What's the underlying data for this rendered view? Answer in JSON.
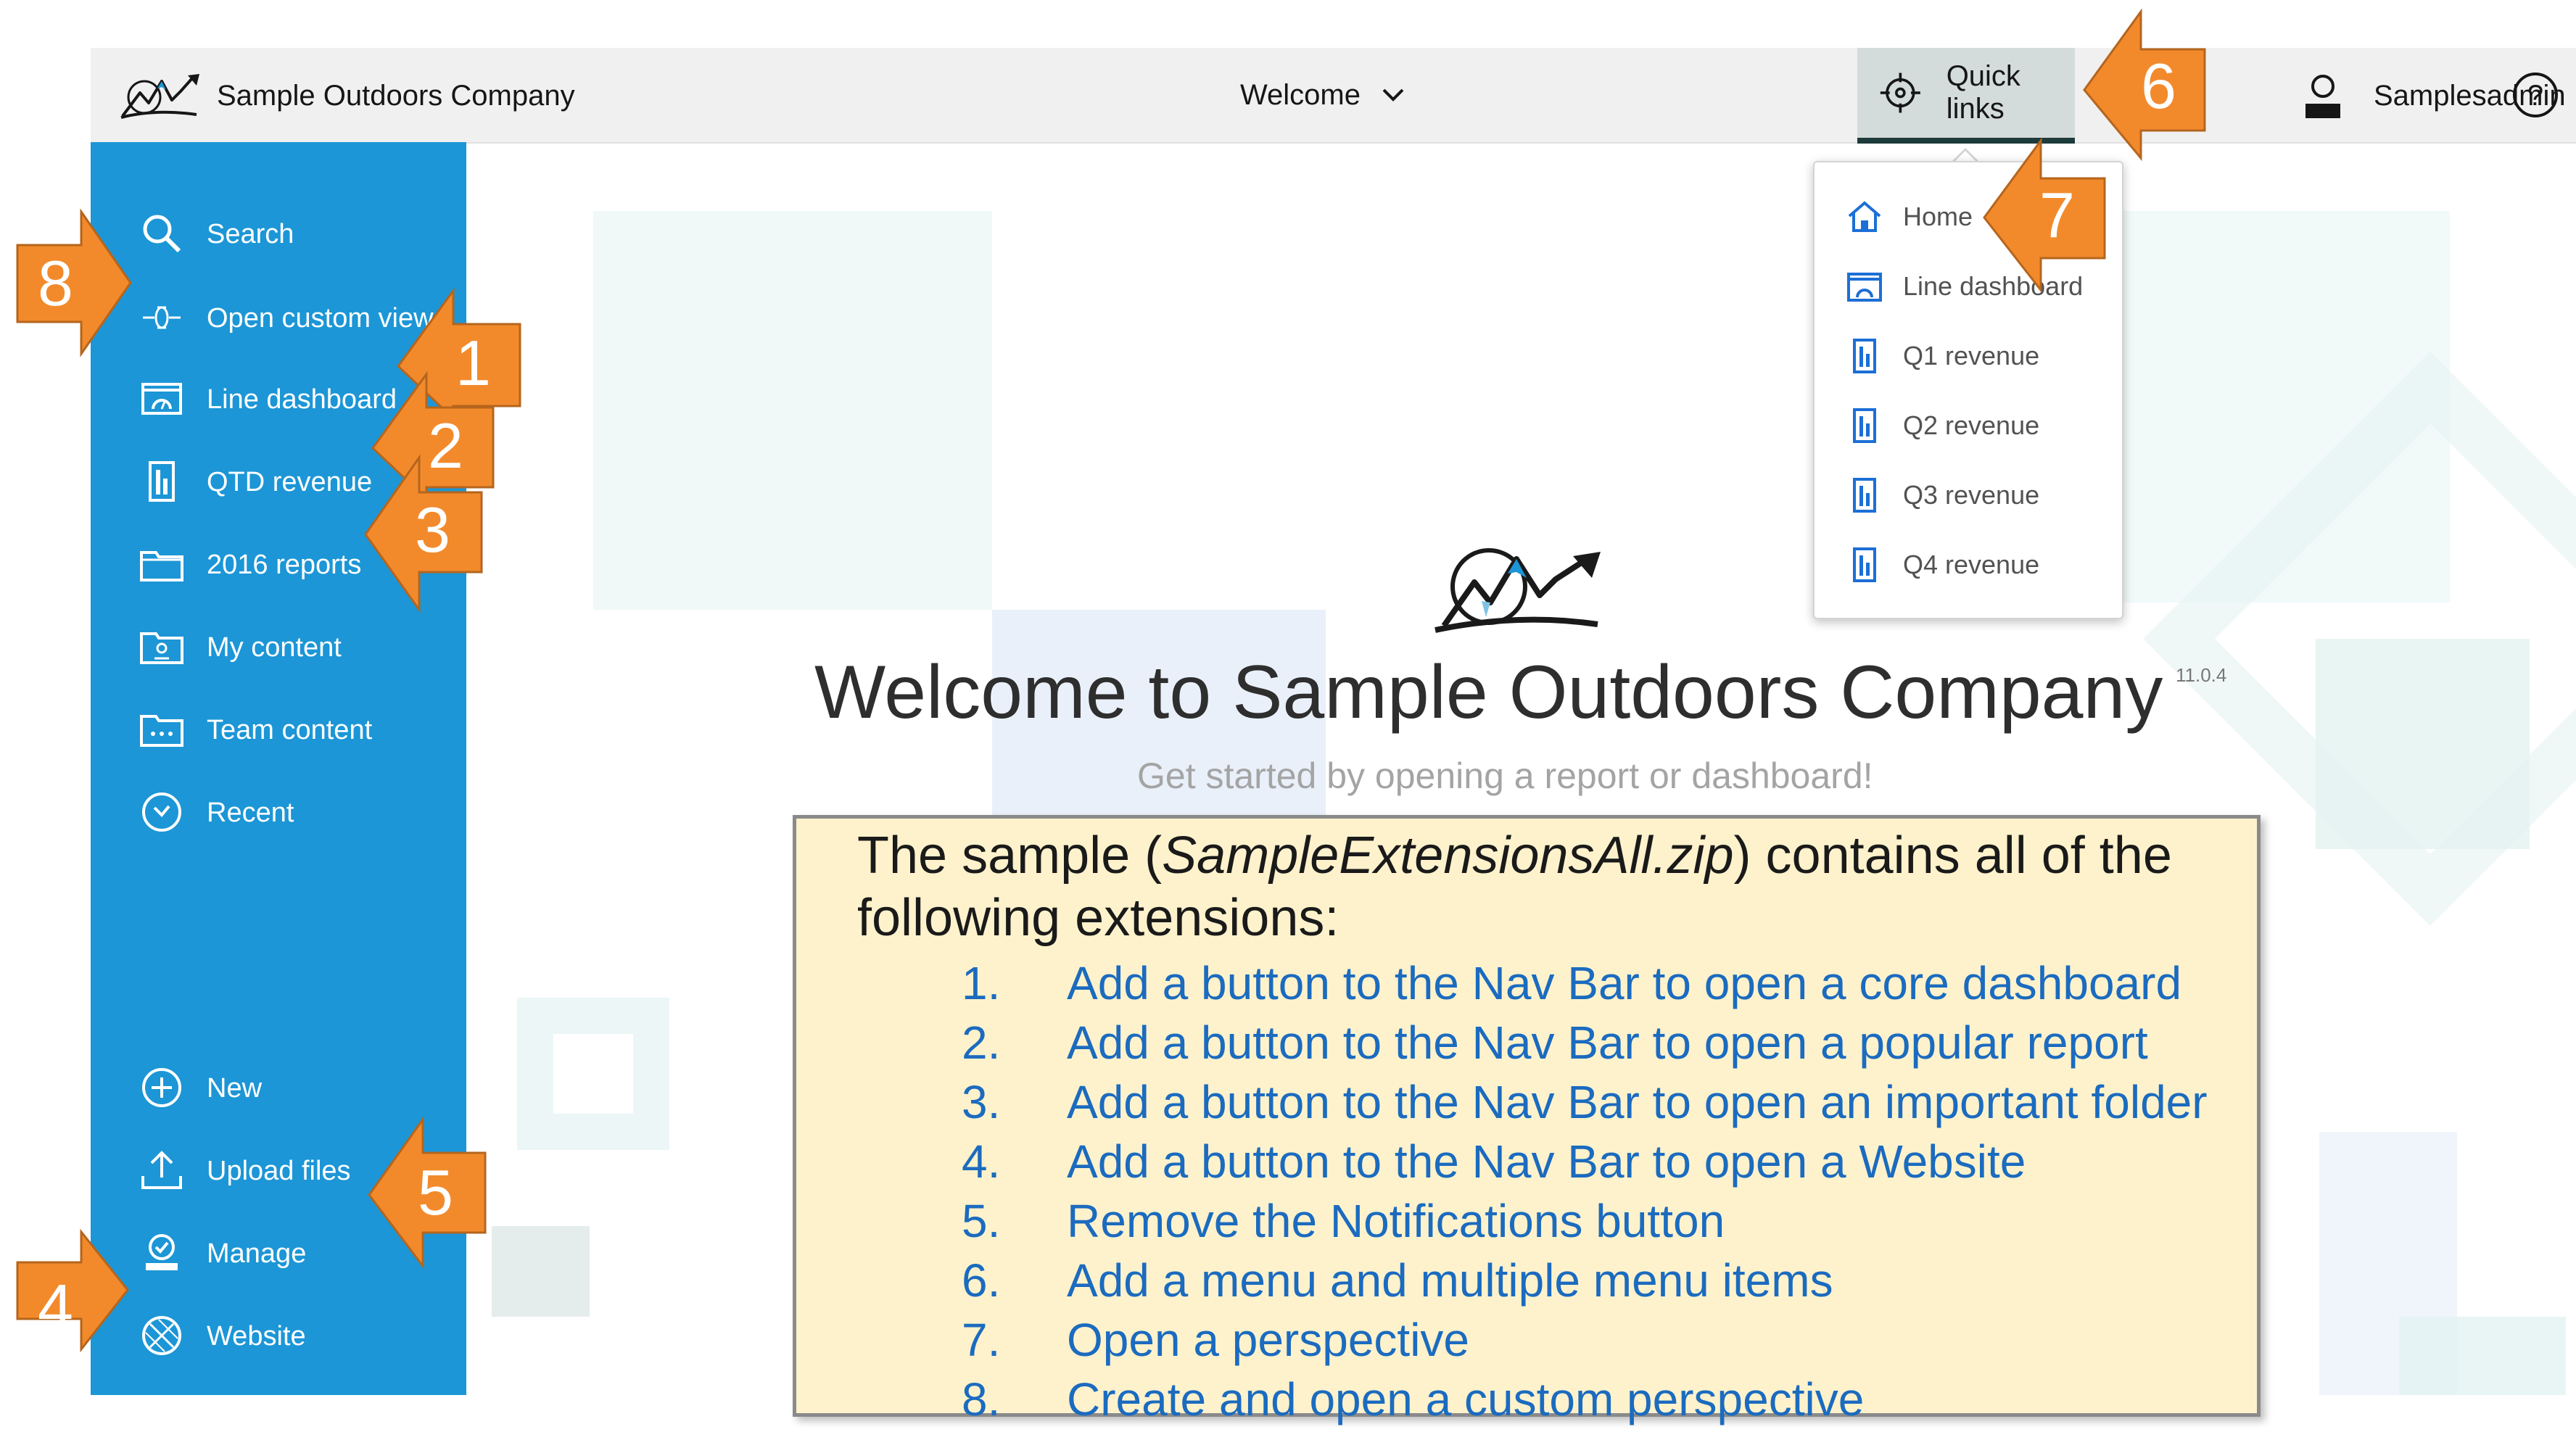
{
  "colors": {
    "sidebar": "#1c96d6",
    "topbar": "#f0f0f0",
    "accent_orange": "#f28a2c",
    "callout_bg": "#fef2cc",
    "list_text": "#1b6bbf"
  },
  "header": {
    "brand_name": "Sample Outdoors Company",
    "welcome_label": "Welcome",
    "quick_links_label": "Quick links",
    "user_name": "Samplesadmin",
    "help_icon": "help-icon"
  },
  "sidebar": {
    "top_items": [
      {
        "label": "Search",
        "icon": "search-icon"
      },
      {
        "label": "Open custom view",
        "icon": "custom-view-icon"
      },
      {
        "label": "Line dashboard",
        "icon": "dashboard-icon"
      },
      {
        "label": "QTD revenue",
        "icon": "report-icon"
      },
      {
        "label": "2016 reports",
        "icon": "folder-icon"
      },
      {
        "label": "My content",
        "icon": "my-content-icon"
      },
      {
        "label": "Team content",
        "icon": "team-content-icon"
      },
      {
        "label": "Recent",
        "icon": "clock-icon"
      }
    ],
    "bottom_items": [
      {
        "label": "New",
        "icon": "plus-circle-icon"
      },
      {
        "label": "Upload files",
        "icon": "upload-icon"
      },
      {
        "label": "Manage",
        "icon": "manage-icon"
      },
      {
        "label": "Website",
        "icon": "globe-icon"
      }
    ]
  },
  "quick_links_menu": {
    "items": [
      {
        "label": "Home",
        "icon": "home-icon"
      },
      {
        "label": "Line dashboard",
        "icon": "dashboard-icon"
      },
      {
        "label": "Q1 revenue",
        "icon": "report-icon"
      },
      {
        "label": "Q2 revenue",
        "icon": "report-icon"
      },
      {
        "label": "Q3 revenue",
        "icon": "report-icon"
      },
      {
        "label": "Q4 revenue",
        "icon": "report-icon"
      }
    ]
  },
  "main": {
    "title": "Welcome to Sample Outdoors Company",
    "version": "11.0.4",
    "subtitle": "Get started by opening a report or dashboard!"
  },
  "callout": {
    "intro_prefix": "The sample (",
    "intro_filename": "SampleExtensionsAll.zip",
    "intro_suffix": ") contains all of the following extensions:",
    "items": [
      {
        "num": "1.",
        "text": "Add a button to the Nav Bar to open a core dashboard"
      },
      {
        "num": "2.",
        "text": "Add a button to the Nav Bar to open a popular report"
      },
      {
        "num": "3.",
        "text": "Add a button to the Nav Bar to open an important folder"
      },
      {
        "num": "4.",
        "text": "Add a button to the Nav Bar to open a Website"
      },
      {
        "num": "5.",
        "text": "Remove the Notifications button"
      },
      {
        "num": "6.",
        "text": "Add a menu and multiple menu items"
      },
      {
        "num": "7.",
        "text": "Open a perspective"
      },
      {
        "num": "8.",
        "text": "Create and open a custom perspective"
      }
    ]
  },
  "annotations": [
    "1",
    "2",
    "3",
    "4",
    "5",
    "6",
    "7",
    "8"
  ]
}
